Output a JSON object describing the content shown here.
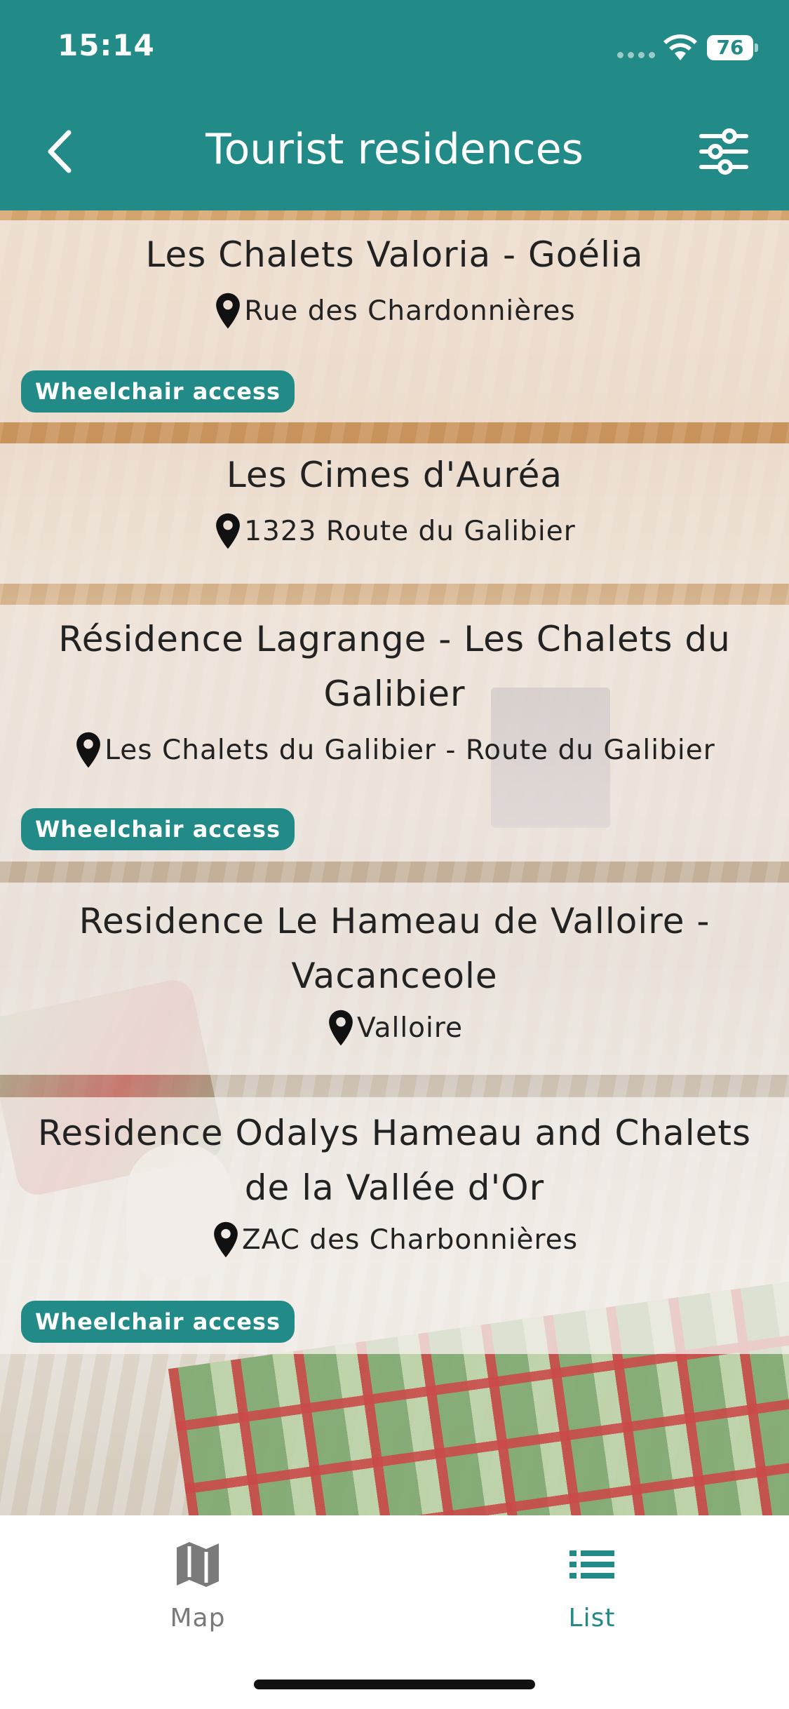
{
  "status_bar": {
    "time": "15:14",
    "battery": "76"
  },
  "header": {
    "title": "Tourist residences"
  },
  "residences": [
    {
      "name": "Les Chalets Valoria - Goélia",
      "address": "Rue des Chardonnières",
      "badge": "Wheelchair access"
    },
    {
      "name": "Les Cimes d'Auréa",
      "address": "1323 Route du Galibier"
    },
    {
      "name": "Résidence Lagrange - Les Chalets du Galibier",
      "address": "Les Chalets du Galibier - Route du Galibier",
      "badge": "Wheelchair access"
    },
    {
      "name": "Residence Le Hameau de Valloire - Vacanceole",
      "address": "Valloire"
    },
    {
      "name": "Residence Odalys Hameau and Chalets de la Vallée d'Or",
      "address": "ZAC des Charbonnières",
      "badge": "Wheelchair access"
    }
  ],
  "bottom_nav": {
    "map_label": "Map",
    "list_label": "List"
  },
  "colors": {
    "accent": "#228B87",
    "card_bg": "#F5F0EC"
  }
}
